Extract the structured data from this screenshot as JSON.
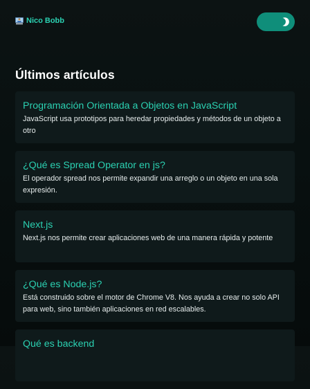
{
  "header": {
    "brand_label": "Nico Bobb",
    "brand_icon": "technologist-emoji",
    "theme_toggle_icon": "half-moon-icon"
  },
  "section": {
    "title": "Últimos artículos"
  },
  "articles": [
    {
      "title": "Programación Orientada a Objetos en JavaScript",
      "description": "JavaScript usa prototipos para heredar propiedades y métodos de un objeto a otro"
    },
    {
      "title": "¿Qué es Spread Operator en js?",
      "description": "El operador spread nos permite expandir una arreglo o un objeto en una sola expresión."
    },
    {
      "title": "Next.js",
      "description": "Next.js nos permite crear aplicaciones web de una manera rápida y potente"
    },
    {
      "title": "¿Qué es Node.js?",
      "description": "Está construido sobre el motor de Chrome V8. Nos ayuda a crear no solo API para web, sino también aplicaciones en red escalables."
    },
    {
      "title": "Qué es backend",
      "description": ""
    }
  ],
  "colors": {
    "accent": "#2bd1b2",
    "toggle_bg": "#0f8e7a",
    "card_bg": "#0f1a1b",
    "page_bg": "#081010"
  }
}
